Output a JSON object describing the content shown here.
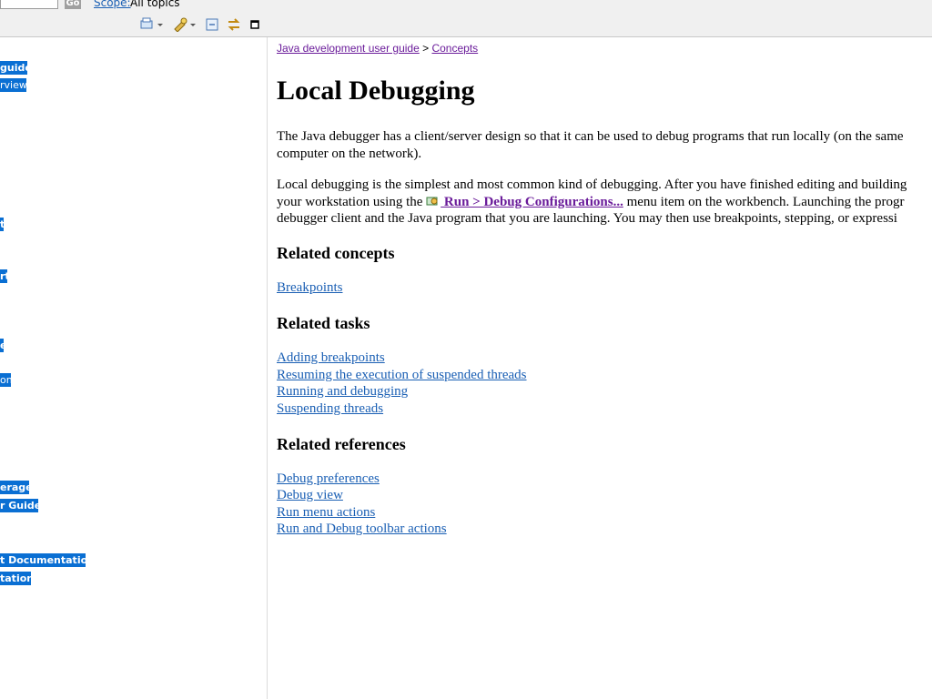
{
  "search": {
    "go_label": "Go",
    "scope_label": "Scope:",
    "scope_value": "All topics"
  },
  "nav": {
    "items": [
      {
        "label": "guide"
      },
      {
        "label": "rview"
      },
      {
        "label": "t"
      },
      {
        "label": "rt"
      },
      {
        "label": "e"
      },
      {
        "label": "on"
      },
      {
        "label": "erage"
      },
      {
        "label": "r Guide"
      },
      {
        "label": "t Documentation"
      },
      {
        "label": "tation"
      }
    ]
  },
  "content": {
    "breadcrumb": {
      "part1": "Java development user guide",
      "sep": " > ",
      "part2": "Concepts"
    },
    "title": "Local Debugging",
    "para1_line1": "The Java debugger has a client/server design so that it can be used to debug programs that run locally (on the same",
    "para1_line2": "computer on the network).",
    "para2_line1": "Local debugging is the simplest and most common kind of debugging.  After you have finished editing and building",
    "para2_line2_pre": "your workstation using the ",
    "para2_line2_cmd": " Run > Debug Configurations...",
    "para2_line2_post": " menu item on the workbench.  Launching the progr",
    "para2_line3": "debugger client and the Java program that you are launching.  You may then use breakpoints, stepping, or expressi",
    "sections": {
      "concepts_title": "Related concepts",
      "concepts": [
        "Breakpoints"
      ],
      "tasks_title": "Related tasks",
      "tasks": [
        "Adding breakpoints",
        "Resuming the execution of suspended threads",
        "Running and debugging",
        "Suspending threads"
      ],
      "refs_title": "Related references",
      "refs": [
        "Debug preferences",
        "Debug view",
        "Run menu actions",
        "Run and Debug toolbar actions"
      ]
    }
  }
}
